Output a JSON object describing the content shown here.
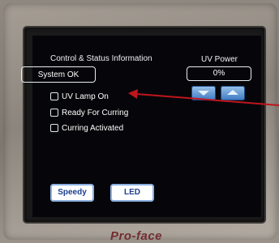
{
  "status_section": {
    "title": "Control & Status Information",
    "status_text": "System OK"
  },
  "uv_power": {
    "title": "UV Power",
    "value": "0%",
    "down_icon": "triangle-down-icon",
    "up_icon": "triangle-up-icon"
  },
  "checkboxes": [
    {
      "label": "UV Lamp On",
      "checked": false
    },
    {
      "label": "Ready For Curring",
      "checked": false
    },
    {
      "label": "Curring Activated",
      "checked": false
    }
  ],
  "buttons": {
    "speedy": "Speedy",
    "led": "LED"
  },
  "brand": "Pro-face",
  "colors": {
    "screen_bg": "#06060a",
    "button_blue": "#3a78c2",
    "annotation_arrow": "#c0151c"
  }
}
